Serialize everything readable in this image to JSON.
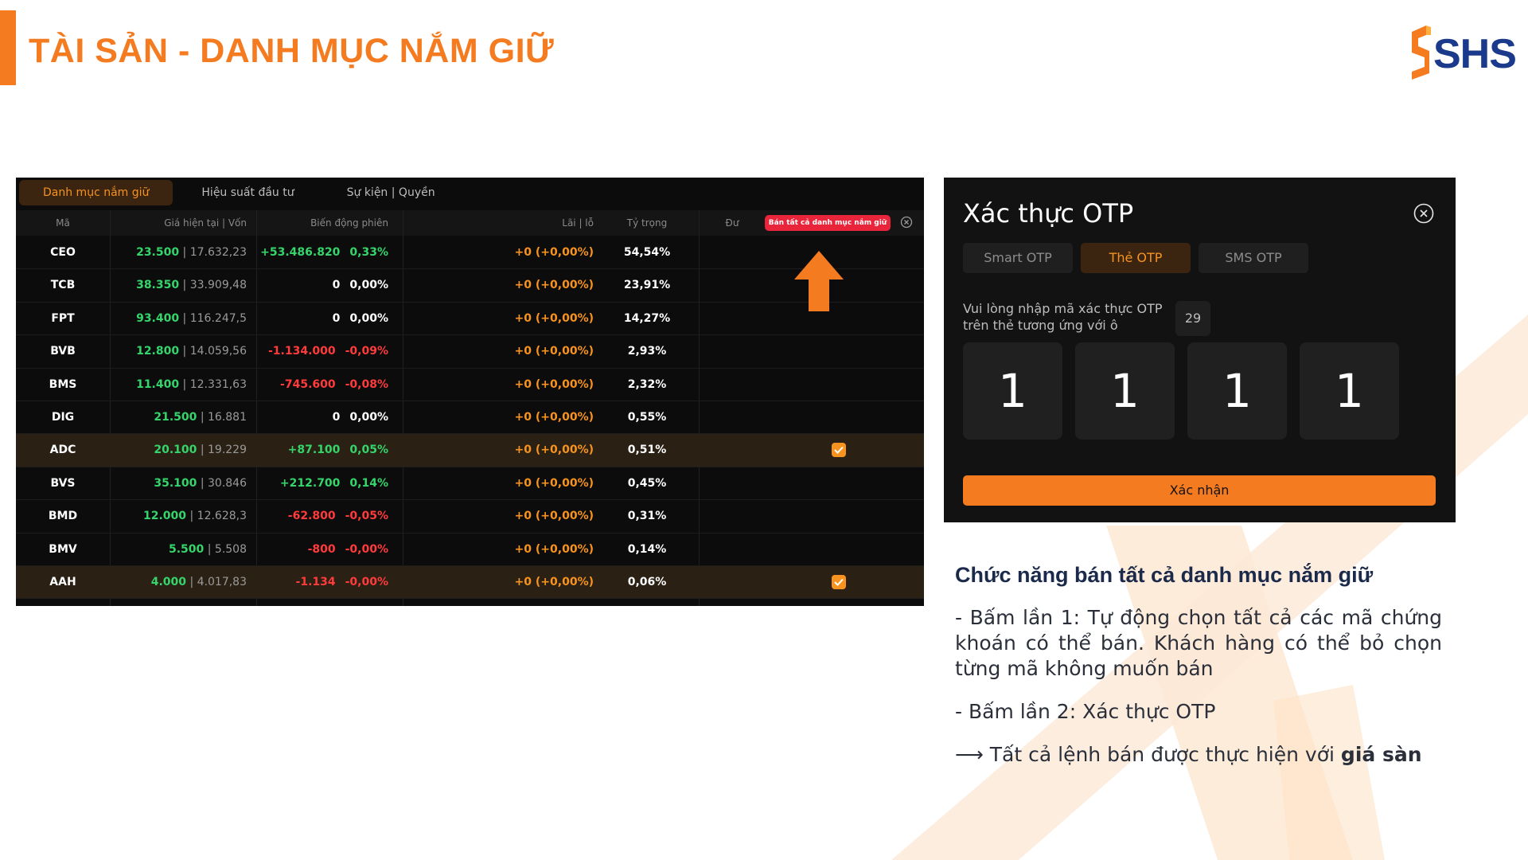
{
  "slide": {
    "title": "TÀI SẢN - DANH MỤC NẮM GIỮ",
    "logo_text": "SHS",
    "colors": {
      "accent": "#f47b20",
      "navy": "#1b3a8c"
    }
  },
  "portfolio": {
    "tabs": [
      {
        "label": "Danh mục nắm giữ",
        "active": true
      },
      {
        "label": "Hiệu suất đầu tư",
        "active": false
      },
      {
        "label": "Sự kiện | Quyền",
        "active": false
      }
    ],
    "headers": {
      "symbol": "Mã",
      "price": "Giá hiện tại | Vốn",
      "change": "Biến động phiên",
      "pl": "Lãi | lỗ",
      "weight": "Tỷ trọng",
      "du": "Đư"
    },
    "sell_all_button": "Bán tất cả danh mục nắm giữ",
    "rows": [
      {
        "symbol": "CEO",
        "price": "23.500",
        "cost": "17.632,23",
        "change": "+53.486.820",
        "change_pct": "0,33%",
        "direction": "up",
        "pl": "+0 (+0,00%)",
        "weight": "54,54%",
        "selected": false
      },
      {
        "symbol": "TCB",
        "price": "38.350",
        "cost": "33.909,48",
        "change": "0",
        "change_pct": "0,00%",
        "direction": "flat",
        "pl": "+0 (+0,00%)",
        "weight": "23,91%",
        "selected": false
      },
      {
        "symbol": "FPT",
        "price": "93.400",
        "cost": "116.247,5",
        "change": "0",
        "change_pct": "0,00%",
        "direction": "flat",
        "pl": "+0 (+0,00%)",
        "weight": "14,27%",
        "selected": false
      },
      {
        "symbol": "BVB",
        "price": "12.800",
        "cost": "14.059,56",
        "change": "-1.134.000",
        "change_pct": "-0,09%",
        "direction": "down",
        "pl": "+0 (+0,00%)",
        "weight": "2,93%",
        "selected": false
      },
      {
        "symbol": "BMS",
        "price": "11.400",
        "cost": "12.331,63",
        "change": "-745.600",
        "change_pct": "-0,08%",
        "direction": "down",
        "pl": "+0 (+0,00%)",
        "weight": "2,32%",
        "selected": false
      },
      {
        "symbol": "DIG",
        "price": "21.500",
        "cost": "16.881",
        "change": "0",
        "change_pct": "0,00%",
        "direction": "flat",
        "pl": "+0 (+0,00%)",
        "weight": "0,55%",
        "selected": false
      },
      {
        "symbol": "ADC",
        "price": "20.100",
        "cost": "19.229",
        "change": "+87.100",
        "change_pct": "0,05%",
        "direction": "up",
        "pl": "+0 (+0,00%)",
        "weight": "0,51%",
        "selected": true
      },
      {
        "symbol": "BVS",
        "price": "35.100",
        "cost": "30.846",
        "change": "+212.700",
        "change_pct": "0,14%",
        "direction": "up",
        "pl": "+0 (+0,00%)",
        "weight": "0,45%",
        "selected": false
      },
      {
        "symbol": "BMD",
        "price": "12.000",
        "cost": "12.628,3",
        "change": "-62.800",
        "change_pct": "-0,05%",
        "direction": "down",
        "pl": "+0 (+0,00%)",
        "weight": "0,31%",
        "selected": false
      },
      {
        "symbol": "BMV",
        "price": "5.500",
        "cost": "5.508",
        "change": "-800",
        "change_pct": "-0,00%",
        "direction": "down",
        "pl": "+0 (+0,00%)",
        "weight": "0,14%",
        "selected": false
      },
      {
        "symbol": "AAH",
        "price": "4.000",
        "cost": "4.017,83",
        "change": "-1.134",
        "change_pct": "-0,00%",
        "direction": "down",
        "pl": "+0 (+0,00%)",
        "weight": "0,06%",
        "selected": true
      }
    ]
  },
  "otp": {
    "title": "Xác thực OTP",
    "tabs": [
      {
        "label": "Smart OTP",
        "active": false
      },
      {
        "label": "Thẻ OTP",
        "active": true
      },
      {
        "label": "SMS OTP",
        "active": false
      }
    ],
    "instruction": "Vui lòng nhập mã xác thực OTP trên thẻ tương ứng với ô",
    "cell_index": "29",
    "digits": [
      "1",
      "1",
      "1",
      "1"
    ],
    "confirm_label": "Xác nhận"
  },
  "description": {
    "title": "Chức năng bán tất cả danh mục nắm giữ",
    "step1": "- Bấm lần 1: Tự động chọn tất cả các mã chứng khoán có thể bán. Khách hàng có thể bỏ chọn từng mã không muốn bán",
    "step2": "- Bấm lần 2: Xác thực OTP",
    "result_prefix": "⟶ Tất cả lệnh bán được thực hiện với ",
    "result_bold": "giá sàn"
  }
}
